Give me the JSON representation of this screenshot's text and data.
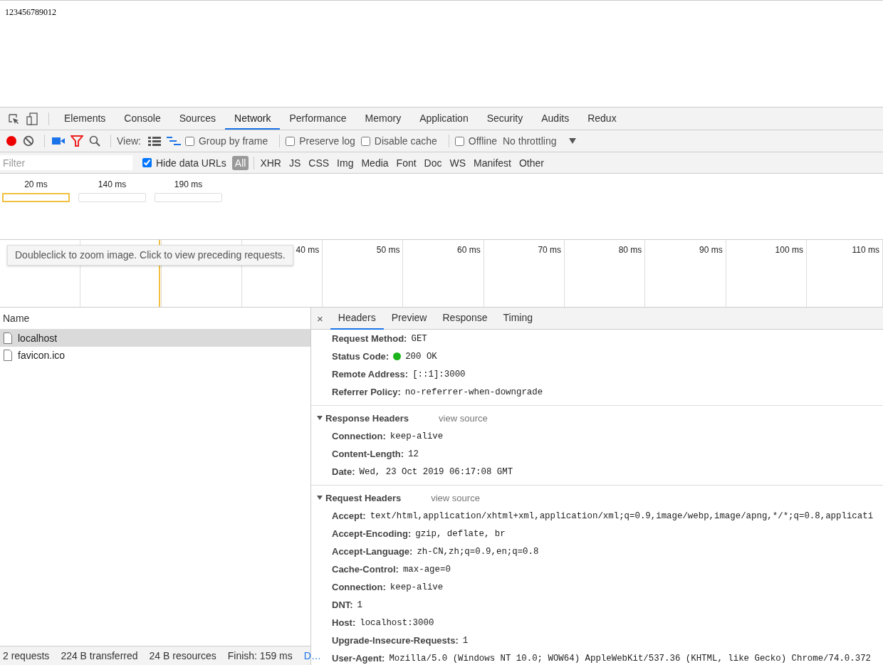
{
  "page": {
    "text": "123456789012"
  },
  "panel_tabs": [
    {
      "label": "Elements",
      "selected": false
    },
    {
      "label": "Console",
      "selected": false
    },
    {
      "label": "Sources",
      "selected": false
    },
    {
      "label": "Network",
      "selected": true
    },
    {
      "label": "Performance",
      "selected": false
    },
    {
      "label": "Memory",
      "selected": false
    },
    {
      "label": "Application",
      "selected": false
    },
    {
      "label": "Security",
      "selected": false
    },
    {
      "label": "Audits",
      "selected": false
    },
    {
      "label": "Redux",
      "selected": false
    }
  ],
  "toolbar": {
    "recording": true,
    "view_label": "View:",
    "frame_checkbox": {
      "label": "Group by frame",
      "checked": false
    },
    "checkboxes": [
      {
        "label": "Preserve log",
        "checked": false
      },
      {
        "label": "Disable cache",
        "checked": false
      }
    ],
    "offline": {
      "label": "Offline",
      "checked": false
    },
    "throttling": "No throttling"
  },
  "filter_bar": {
    "placeholder": "Filter",
    "hide_data_urls": {
      "label": "Hide data URLs",
      "checked": true
    },
    "types": [
      {
        "label": "All",
        "selected": true
      },
      {
        "label": "XHR",
        "selected": false
      },
      {
        "label": "JS",
        "selected": false
      },
      {
        "label": "CSS",
        "selected": false
      },
      {
        "label": "Img",
        "selected": false
      },
      {
        "label": "Media",
        "selected": false
      },
      {
        "label": "Font",
        "selected": false
      },
      {
        "label": "Doc",
        "selected": false
      },
      {
        "label": "WS",
        "selected": false
      },
      {
        "label": "Manifest",
        "selected": false
      },
      {
        "label": "Other",
        "selected": false
      }
    ]
  },
  "overview": {
    "frames": [
      {
        "label": "20 ms",
        "selected": true
      },
      {
        "label": "140 ms",
        "selected": false
      },
      {
        "label": "190 ms",
        "selected": false
      }
    ]
  },
  "timeline": {
    "ticks": [
      "40 ms",
      "50 ms",
      "60 ms",
      "70 ms",
      "80 ms",
      "90 ms",
      "100 ms",
      "110 ms"
    ],
    "tooltip": "Doubleclick to zoom image. Click to view preceding requests."
  },
  "requests": {
    "header": "Name",
    "rows": [
      {
        "name": "localhost",
        "selected": true
      },
      {
        "name": "favicon.ico",
        "selected": false
      }
    ]
  },
  "status_bar": {
    "items": [
      "2 requests",
      "224 B transferred",
      "24 B resources",
      "Finish: 159 ms"
    ],
    "link": "D…"
  },
  "details": {
    "close": "×",
    "tabs": [
      {
        "label": "Headers",
        "selected": true
      },
      {
        "label": "Preview",
        "selected": false
      },
      {
        "label": "Response",
        "selected": false
      },
      {
        "label": "Timing",
        "selected": false
      }
    ],
    "general": [
      {
        "key": "Request Method:",
        "value": "GET"
      },
      {
        "key": "Status Code:",
        "value": "200 OK",
        "kind": "status"
      },
      {
        "key": "Remote Address:",
        "value": "[::1]:3000"
      },
      {
        "key": "Referrer Policy:",
        "value": "no-referrer-when-downgrade"
      }
    ],
    "sections": [
      {
        "title": "Response Headers",
        "expanded": true,
        "link": "view source",
        "headers": [
          {
            "key": "Connection:",
            "value": "keep-alive"
          },
          {
            "key": "Content-Length:",
            "value": "12"
          },
          {
            "key": "Date:",
            "value": "Wed, 23 Oct 2019 06:17:08 GMT"
          }
        ]
      },
      {
        "title": "Request Headers",
        "expanded": true,
        "link": "view source",
        "headers": [
          {
            "key": "Accept:",
            "value": "text/html,application/xhtml+xml,application/xml;q=0.9,image/webp,image/apng,*/*;q=0.8,applicati"
          },
          {
            "key": "Accept-Encoding:",
            "value": "gzip, deflate, br"
          },
          {
            "key": "Accept-Language:",
            "value": "zh-CN,zh;q=0.9,en;q=0.8"
          },
          {
            "key": "Cache-Control:",
            "value": "max-age=0"
          },
          {
            "key": "Connection:",
            "value": "keep-alive"
          },
          {
            "key": "DNT:",
            "value": "1"
          },
          {
            "key": "Host:",
            "value": "localhost:3000"
          },
          {
            "key": "Upgrade-Insecure-Requests:",
            "value": "1"
          },
          {
            "key": "User-Agent:",
            "value": "Mozilla/5.0 (Windows NT 10.0; WOW64) AppleWebKit/537.36 (KHTML, like Gecko) Chrome/74.0.372"
          }
        ]
      }
    ]
  }
}
